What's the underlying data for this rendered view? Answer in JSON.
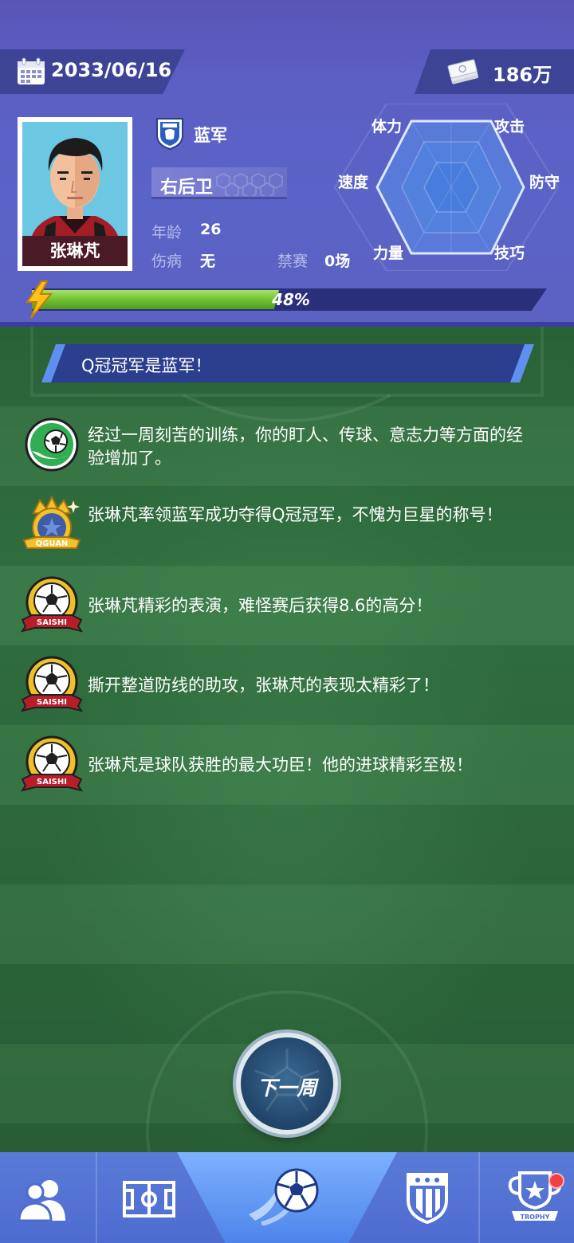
{
  "header": {
    "date": "2033/06/16",
    "money": "186万",
    "player_name": "张琳芃",
    "team_name": "蓝军",
    "position": "右后卫",
    "age_label": "年龄",
    "age_value": "26",
    "injury_label": "伤病",
    "injury_value": "无",
    "suspension_label": "禁赛",
    "suspension_value": "0场",
    "progress_text": "48%",
    "progress_value": 0.48
  },
  "radar": {
    "labels": {
      "stamina": "体力",
      "attack": "攻击",
      "speed": "速度",
      "defense": "防守",
      "strength": "力量",
      "technique": "技巧"
    }
  },
  "banner": {
    "text": "Q冠冠军是蓝军！"
  },
  "news": [
    {
      "icon": "training-ball-icon",
      "text": "经过一周刻苦的训练，你的盯人、传球、意志力等方面的经验增加了。"
    },
    {
      "icon": "qguan-crown-icon",
      "text": "张琳芃率领蓝军成功夺得Q冠冠军，不愧为巨星的称号！"
    },
    {
      "icon": "saishi-ball-icon",
      "text": "张琳芃精彩的表演，难怪赛后获得8.6的高分！"
    },
    {
      "icon": "saishi-ball-icon",
      "text": "撕开整道防线的助攻，张琳芃的表现太精彩了！"
    },
    {
      "icon": "saishi-ball-icon",
      "text": "张琳芃是球队获胜的最大功臣！他的进球精彩至极！"
    }
  ],
  "icon_text": {
    "qguan": "QGUAN",
    "saishi": "SAISHI",
    "trophy": "TROPHY"
  },
  "next_button": {
    "label": "下一周"
  },
  "nav": {
    "items": [
      "team-icon",
      "pitch-icon",
      "match-ball-icon",
      "club-badge-icon",
      "trophy-icon"
    ]
  },
  "colors": {
    "header_bg": "#5a5fc4",
    "panel_bg": "#3d4496",
    "progress_green": "#6ebd2e",
    "banner_bg": "#2b3f8e",
    "nav_bg": "#4e6cd0",
    "nav_active": "#7db1ff"
  }
}
